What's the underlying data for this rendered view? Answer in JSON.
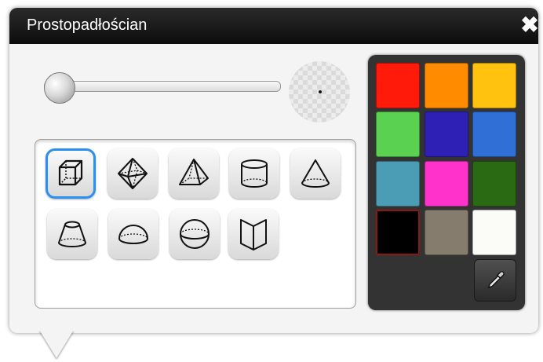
{
  "window": {
    "title": "Prostopadłościan",
    "close_icon": "close-icon"
  },
  "size_slider": {
    "value": 0.0
  },
  "shapes": [
    {
      "name": "cuboid",
      "icon": "cuboid-icon",
      "selected": true
    },
    {
      "name": "octahedron",
      "icon": "octahedron-icon",
      "selected": false
    },
    {
      "name": "pyramid",
      "icon": "pyramid-icon",
      "selected": false
    },
    {
      "name": "cylinder",
      "icon": "cylinder-icon",
      "selected": false
    },
    {
      "name": "cone",
      "icon": "cone-icon",
      "selected": false
    },
    {
      "name": "frustum",
      "icon": "frustum-icon",
      "selected": false
    },
    {
      "name": "hemisphere",
      "icon": "hemisphere-icon",
      "selected": false
    },
    {
      "name": "sphere",
      "icon": "sphere-icon",
      "selected": false
    },
    {
      "name": "open-book",
      "icon": "open-book-icon",
      "selected": false
    }
  ],
  "palette": {
    "colors": [
      "#ff1a0a",
      "#ff8c00",
      "#ffc20e",
      "#5ad150",
      "#2e1fb5",
      "#2f6fd6",
      "#4b9db5",
      "#ff33cc",
      "#2a6a12",
      "#000000",
      "#857c6e",
      "#fbfbf7"
    ],
    "selected": "#000000",
    "picker_icon": "eyedropper-icon"
  }
}
